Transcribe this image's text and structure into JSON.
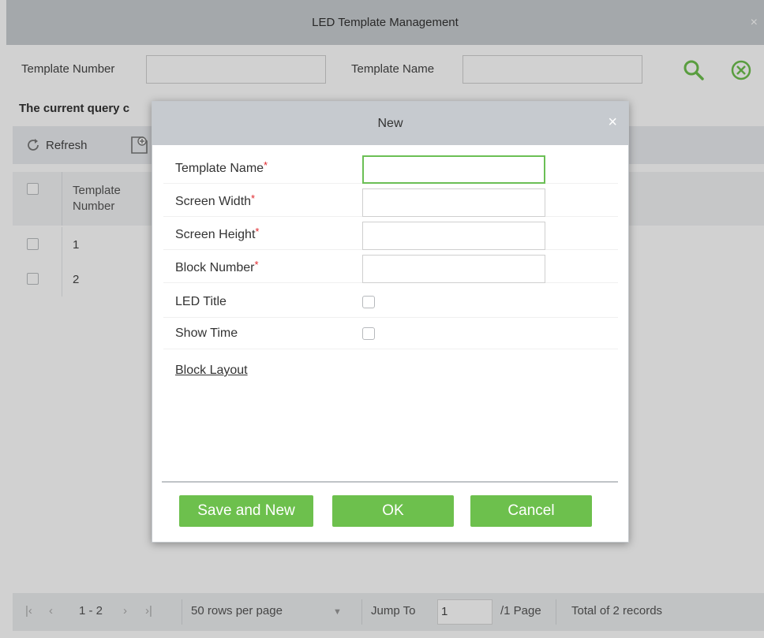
{
  "window": {
    "title": "LED Template Management",
    "close_glyph": "×"
  },
  "search": {
    "template_number_label": "Template Number",
    "template_number_value": "",
    "template_name_label": "Template Name",
    "template_name_value": "",
    "search_icon": "search-icon",
    "clear_icon": "clear-icon"
  },
  "query_text": "The current query c",
  "toolbar": {
    "refresh_label": "Refresh",
    "new_icon": "new-icon"
  },
  "table": {
    "columns": [
      "Template Number"
    ],
    "rows": [
      {
        "template_number": "1"
      },
      {
        "template_number": "2"
      }
    ]
  },
  "pager": {
    "range": "1 - 2",
    "rows_per_page": "50 rows per page",
    "jump_to_label": "Jump To",
    "jump_to_value": "1",
    "page_total": "/1 Page",
    "total_records": "Total of 2 records"
  },
  "dialog": {
    "title": "New",
    "close_glyph": "×",
    "fields": {
      "template_name": {
        "label": "Template Name",
        "required": "*",
        "value": ""
      },
      "screen_width": {
        "label": "Screen Width",
        "required": "*",
        "value": ""
      },
      "screen_height": {
        "label": "Screen Height",
        "required": "*",
        "value": ""
      },
      "block_number": {
        "label": "Block Number",
        "required": "*",
        "value": ""
      },
      "led_title": {
        "label": "LED Title",
        "checked": false
      },
      "show_time": {
        "label": "Show Time",
        "checked": false
      }
    },
    "block_layout_link": "Block Layout",
    "buttons": {
      "save_and_new": "Save and New",
      "ok": "OK",
      "cancel": "Cancel"
    }
  },
  "colors": {
    "accent_green": "#6dc04d",
    "required_red": "#e0262b",
    "titlebar_gray": "#c6cacf"
  }
}
